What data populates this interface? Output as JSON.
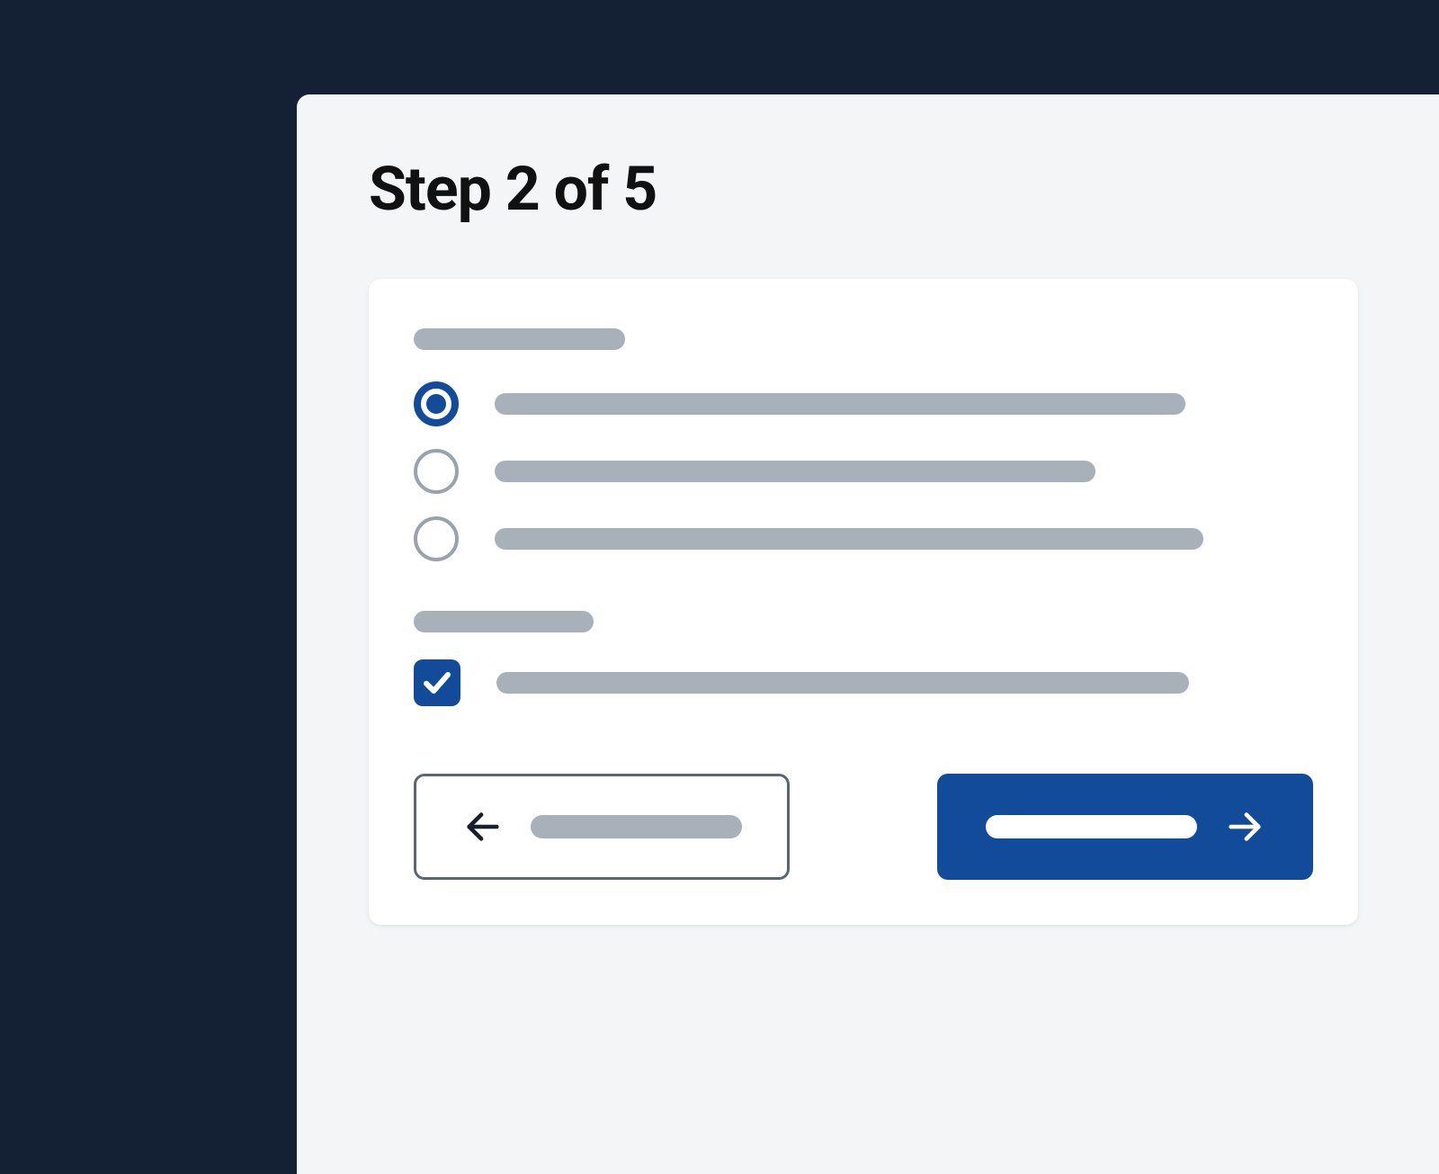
{
  "header": {
    "step_title": "Step 2 of 5"
  },
  "form": {
    "group1": {
      "options": [
        {
          "selected": true
        },
        {
          "selected": false
        },
        {
          "selected": false
        }
      ]
    },
    "group2": {
      "checkbox_checked": true
    }
  },
  "colors": {
    "accent": "#134b9b",
    "muted": "#a8b0b9",
    "page_bg": "#142034",
    "panel_bg": "#f4f5f7"
  }
}
